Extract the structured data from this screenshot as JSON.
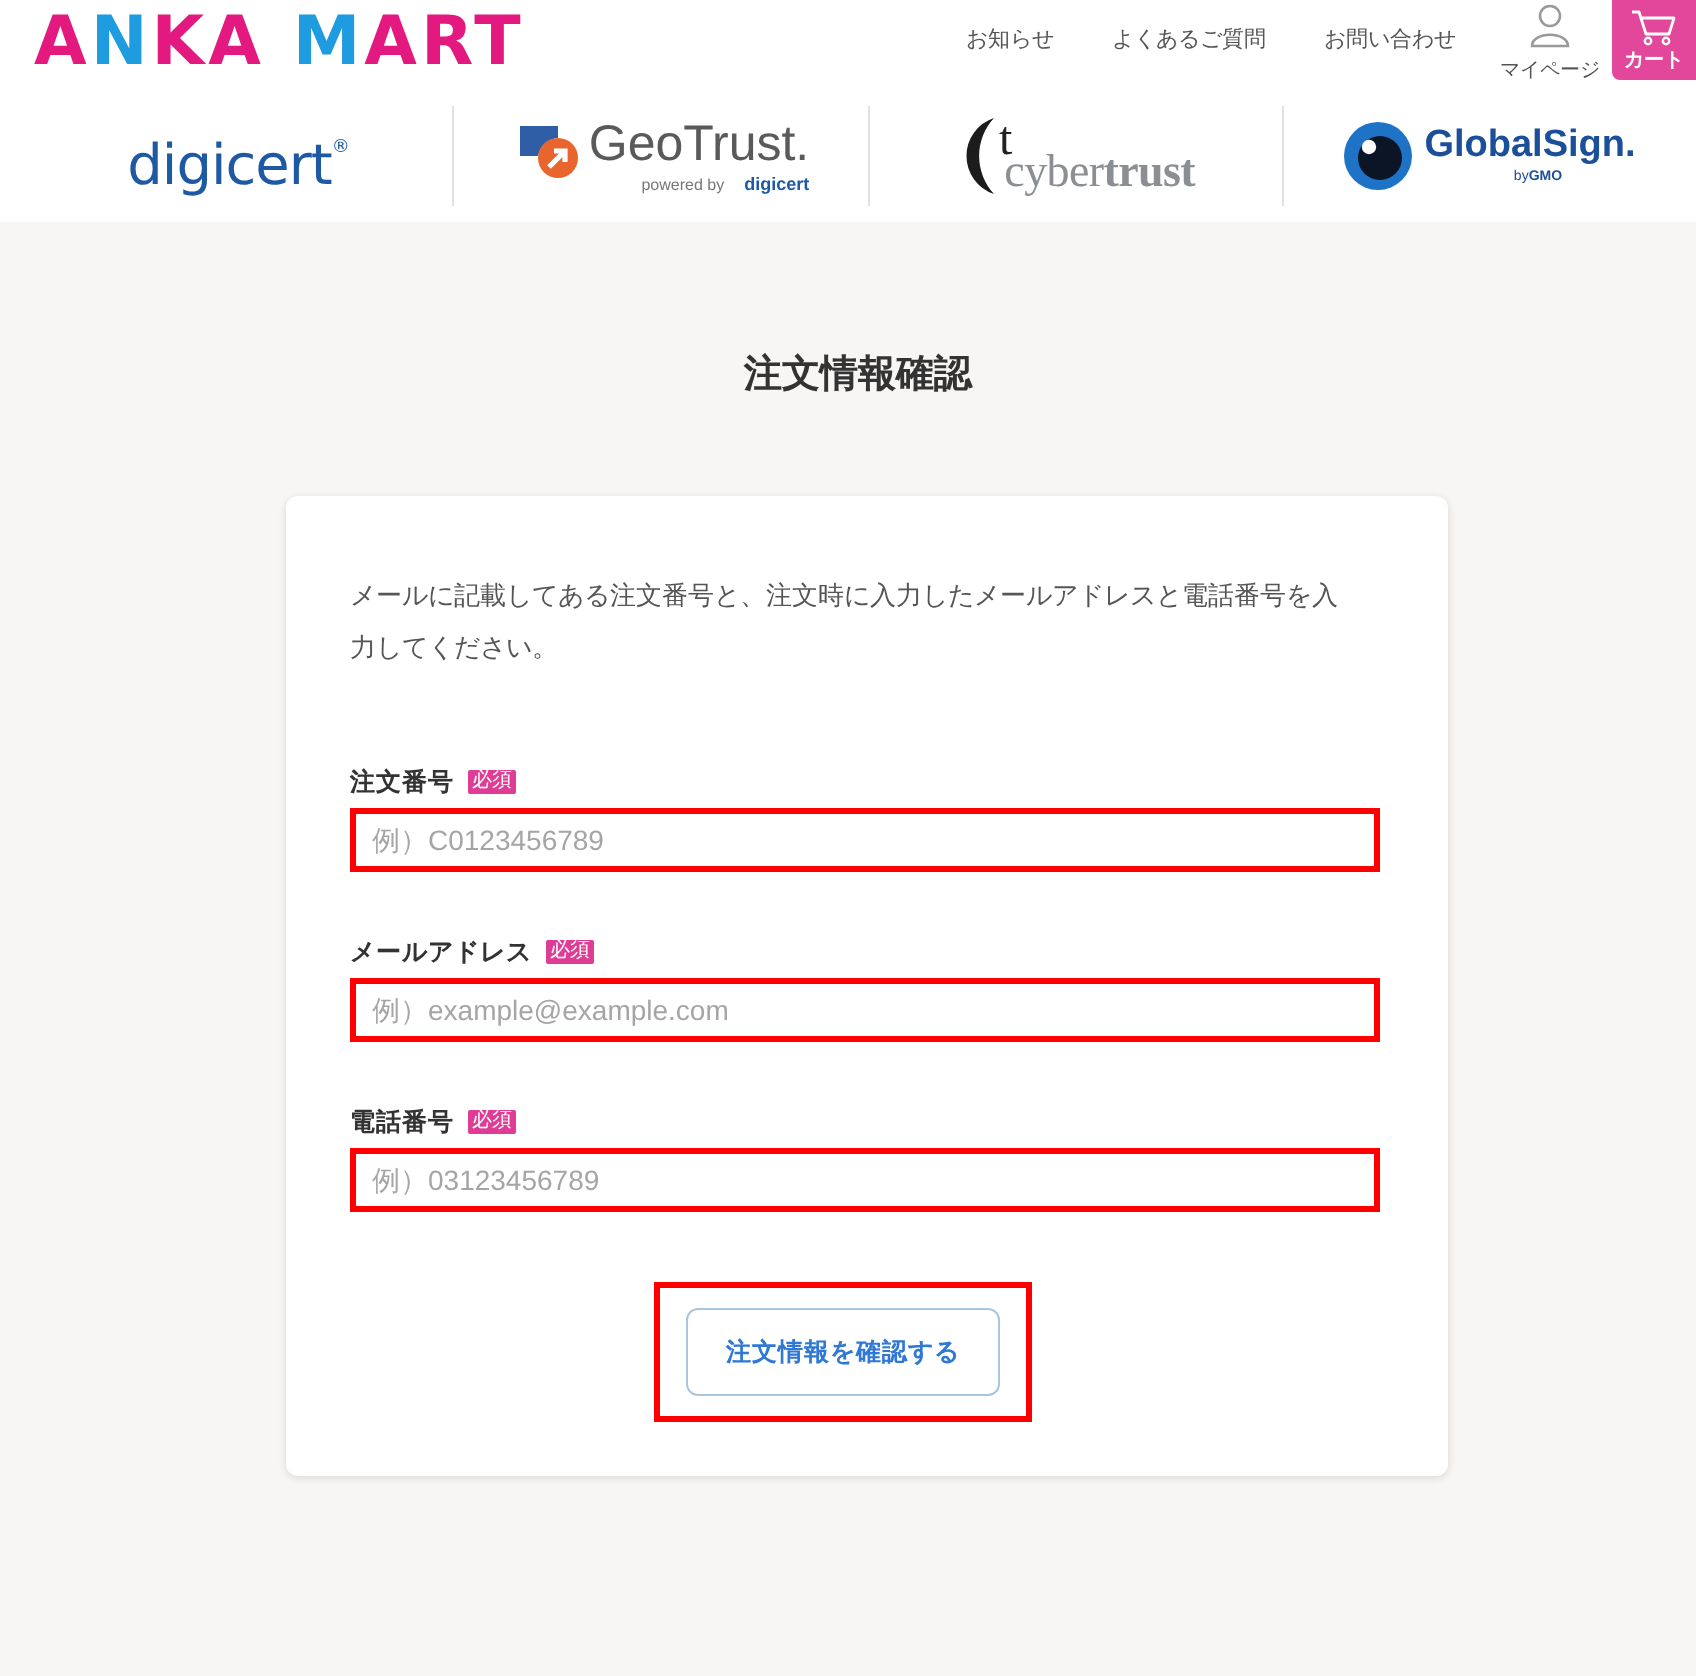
{
  "header": {
    "logo": "ANKA MART",
    "nav": [
      {
        "label": "お知らせ"
      },
      {
        "label": "よくあるご質問"
      },
      {
        "label": "お問い合わせ"
      }
    ],
    "mypage": {
      "label": "マイページ"
    },
    "cart": {
      "label": "カート"
    }
  },
  "cert_logos": [
    {
      "kind": "digicert",
      "name": "digicert$^{®}$"
    },
    {
      "kind": "geotrust",
      "name": "GeoTrust.",
      "tagline": "powered by",
      "vendor": "digicert"
    },
    {
      "kind": "cybertrust",
      "emblem": "t",
      "name": "cyber**trust**"
    },
    {
      "kind": "globalsign",
      "name": "GlobalSign.",
      "tagline": "by**GMO**"
    }
  ],
  "page": {
    "title": "注文情報確認"
  },
  "form": {
    "description": "メールに記載してある注文番号と、注文時に入力したメールアドレスと電話番号を入力してください。",
    "fields": [
      {
        "label": "注文番号",
        "badge": "必須",
        "placeholder": "例）C0123456789",
        "highlighted": true
      },
      {
        "label": "メールアドレス",
        "badge": "必須",
        "placeholder": "例）example@example.com",
        "highlighted": true
      },
      {
        "label": "電話番号",
        "badge": "必須",
        "placeholder": "例）03123456789",
        "highlighted": true
      }
    ],
    "button": {
      "label": "注文情報を確認する",
      "highlighted": true
    }
  }
}
